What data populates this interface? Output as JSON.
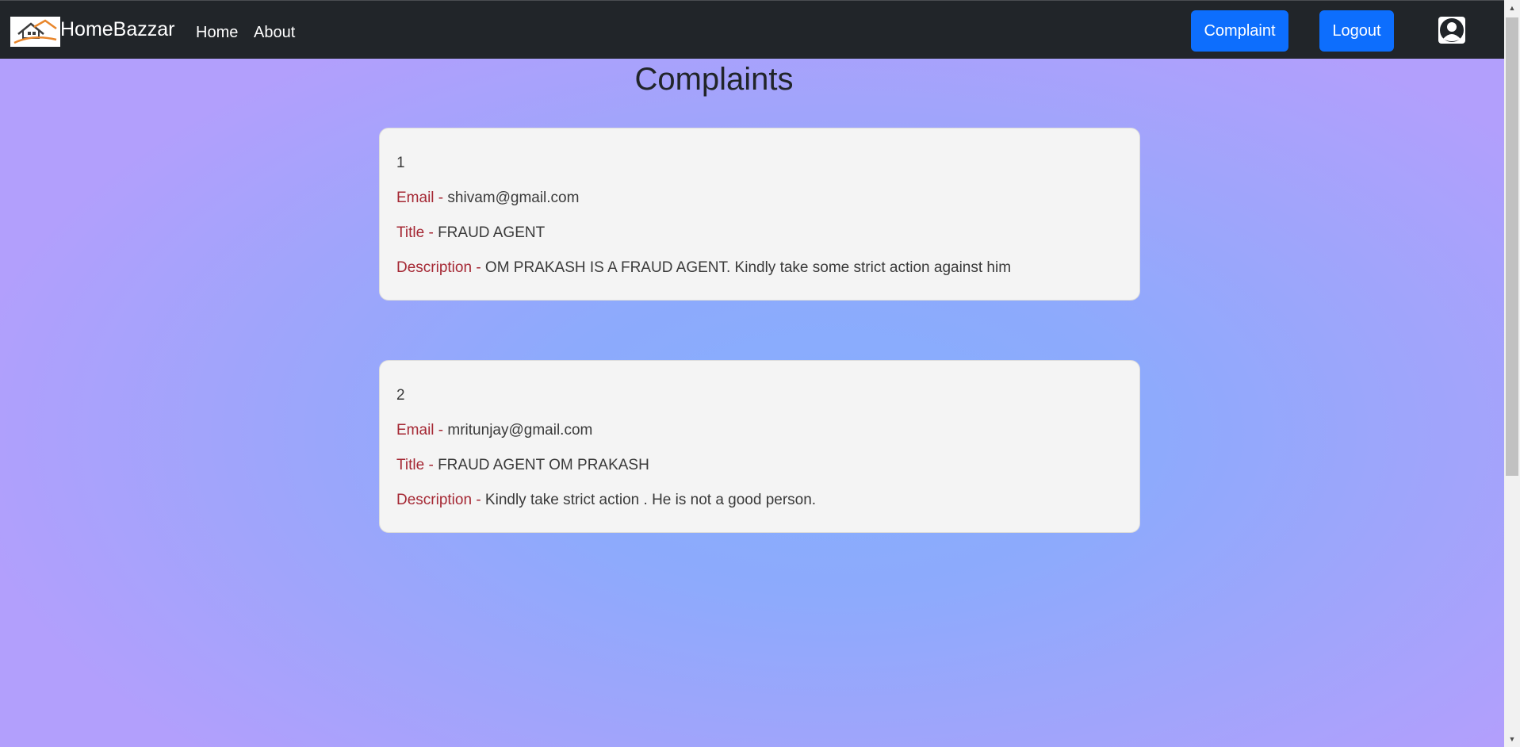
{
  "navbar": {
    "brand": "HomeBazzar",
    "links": [
      "Home",
      "About"
    ],
    "complaint_button": "Complaint",
    "logout_button": "Logout",
    "logo_icon": "house-logo-icon",
    "avatar_icon": "user-avatar-icon",
    "background": "#212529"
  },
  "page": {
    "title": "Complaints"
  },
  "complaints": [
    {
      "number": "1",
      "email_label": "Email - ",
      "email": "shivam@gmail.com",
      "title_label": "Title - ",
      "title": "FRAUD AGENT",
      "description_label": "Description - ",
      "description": "OM PRAKASH IS A FRAUD AGENT. Kindly take some strict action against him"
    },
    {
      "number": "2",
      "email_label": "Email - ",
      "email": "mritunjay@gmail.com",
      "title_label": "Title - ",
      "title": "FRAUD AGENT OM PRAKASH",
      "description_label": "Description - ",
      "description": "Kindly take strict action . He is not a good person."
    }
  ],
  "colors": {
    "accent_button": "#0d6efd",
    "label_red": "#a52834",
    "card_background": "#f4f4f4",
    "gradient_center": "#86aefe",
    "gradient_edge": "#b29ffc"
  }
}
